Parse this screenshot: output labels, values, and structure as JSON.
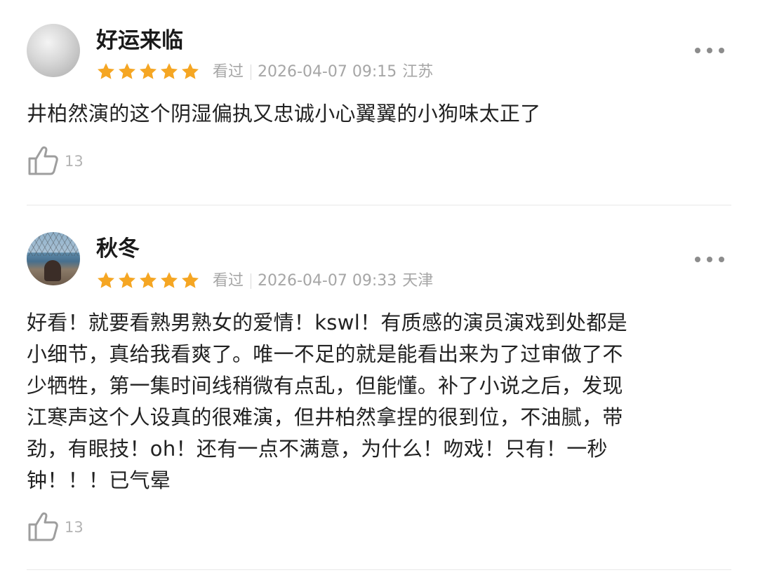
{
  "reviews": [
    {
      "username": "好运来临",
      "rating": 5,
      "watched_label": "看过",
      "datetime": "2026-04-07 09:15",
      "location": "江苏",
      "content": "井柏然演的这个阴湿偏执又忠诚小心翼翼的小狗味太正了",
      "likes": "13"
    },
    {
      "username": "秋冬",
      "rating": 5,
      "watched_label": "看过",
      "datetime": "2026-04-07 09:33",
      "location": "天津",
      "content_lines": [
        "好看！就要看熟男熟女的爱情！kswl！有质感的演员演戏到处都是",
        "小细节，真给我看爽了。唯一不足的就是能看出来为了过审做了不",
        "少牺牲，第一集时间线稍微有点乱，但能懂。补了小说之后，发现",
        "江寒声这个人设真的很难演，但井柏然拿捏的很到位，不油腻，带",
        "劲，有眼技！oh！还有一点不满意，为什么！吻戏！只有！一秒",
        "钟！！！已气晕"
      ],
      "likes": "13"
    }
  ],
  "colors": {
    "star": "#f5a623",
    "meta_text": "#a6a6a6",
    "like_icon": "#9e9e9e"
  },
  "icons": {
    "more": "more-dots-icon",
    "like": "thumbs-up-icon",
    "star": "star-icon"
  }
}
